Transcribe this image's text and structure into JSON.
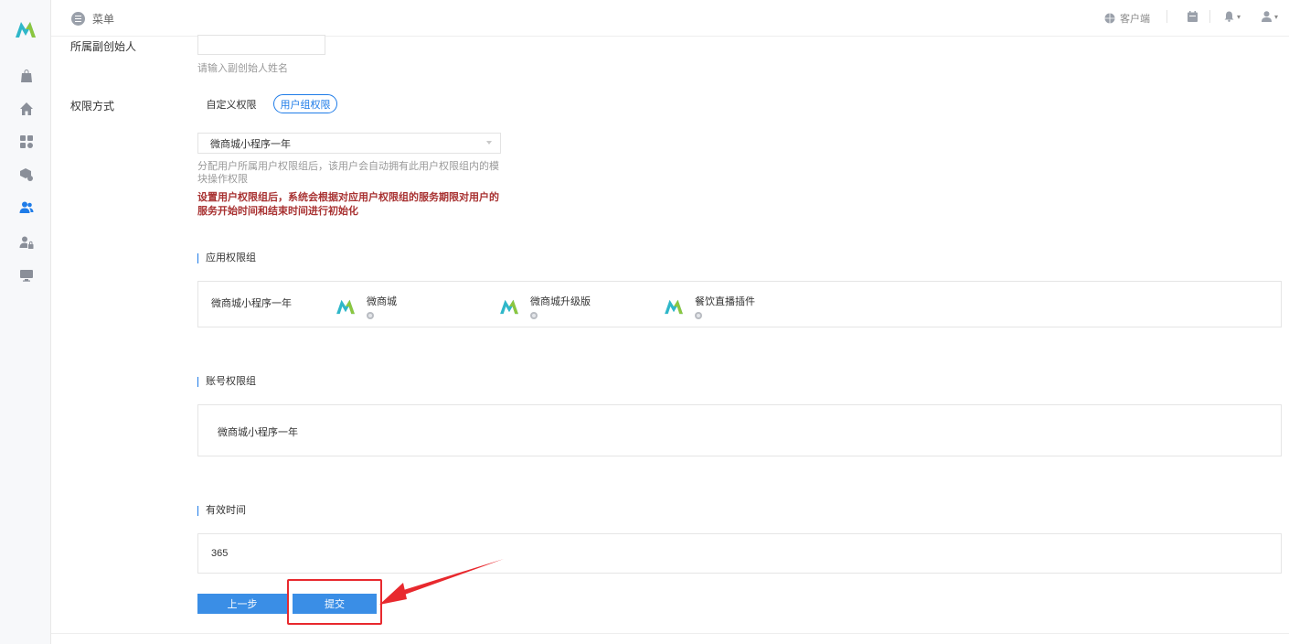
{
  "header": {
    "menu_label": "菜单",
    "client_label": "客户端"
  },
  "form": {
    "founder": {
      "label": "所属副创始人",
      "value": "",
      "hint": "请输入副创始人姓名"
    },
    "permission": {
      "label": "权限方式",
      "tabs": [
        "自定义权限",
        "用户组权限"
      ],
      "active_tab": "用户组权限"
    },
    "group_select": {
      "value": "微商城小程序一年"
    },
    "group_hint": "分配用户所属用户权限组后，该用户会自动拥有此用户权限组内的模块操作权限",
    "warning": "设置用户权限组后，系统会根据对应用户权限组的服务期限对用户的服务开始时间和结束时间进行初始化"
  },
  "app_group": {
    "title": "应用权限组",
    "group_name": "微商城小程序一年",
    "apps": [
      "微商城",
      "微商城升级版",
      "餐饮直播插件"
    ]
  },
  "account_group": {
    "title": "账号权限组",
    "value": "微商城小程序一年"
  },
  "valid_time": {
    "title": "有效时间",
    "value": "365"
  },
  "buttons": {
    "prev": "上一步",
    "submit": "提交"
  },
  "colors": {
    "accent": "#1f7ce8",
    "button": "#3a8ee6",
    "warning": "#a83232",
    "annotation": "#e8292e"
  },
  "icons": {
    "sidebar": [
      "bag-icon",
      "home-icon",
      "apps-settings-icon",
      "package-settings-icon",
      "users-icon",
      "user-lock-icon",
      "monitor-icon"
    ],
    "header": [
      "globe-icon",
      "calendar-icon",
      "bell-icon",
      "user-icon"
    ]
  }
}
